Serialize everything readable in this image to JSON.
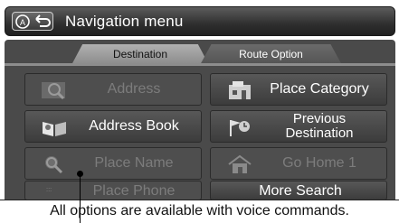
{
  "header": {
    "title": "Navigation menu"
  },
  "tabs": [
    {
      "label": "Destination"
    },
    {
      "label": "Route Option"
    }
  ],
  "buttons": {
    "address": "Address",
    "place_category": "Place Category",
    "address_book": "Address Book",
    "previous_destination_line1": "Previous",
    "previous_destination_line2": "Destination",
    "place_name": "Place Name",
    "go_home": "Go Home 1",
    "place_phone": "Place Phone",
    "more_search": "More Search"
  },
  "footer": {
    "note": "All options are available with voice commands."
  },
  "colors": {
    "panel": "#4a4a4a",
    "button_enabled": "#4a4a4a",
    "button_disabled": "#4e4e4e",
    "disabled_text": "#7c7c7c"
  },
  "icons": {
    "home_indicator": "circle-a-icon",
    "back": "back-arrow-icon",
    "address": "magnifier-icon",
    "place_category": "building-icon",
    "address_book": "open-book-icon",
    "previous_destination": "flag-clock-icon",
    "place_name": "magnifier-name-icon",
    "go_home": "house-icon",
    "place_phone": "keypad-icon"
  }
}
